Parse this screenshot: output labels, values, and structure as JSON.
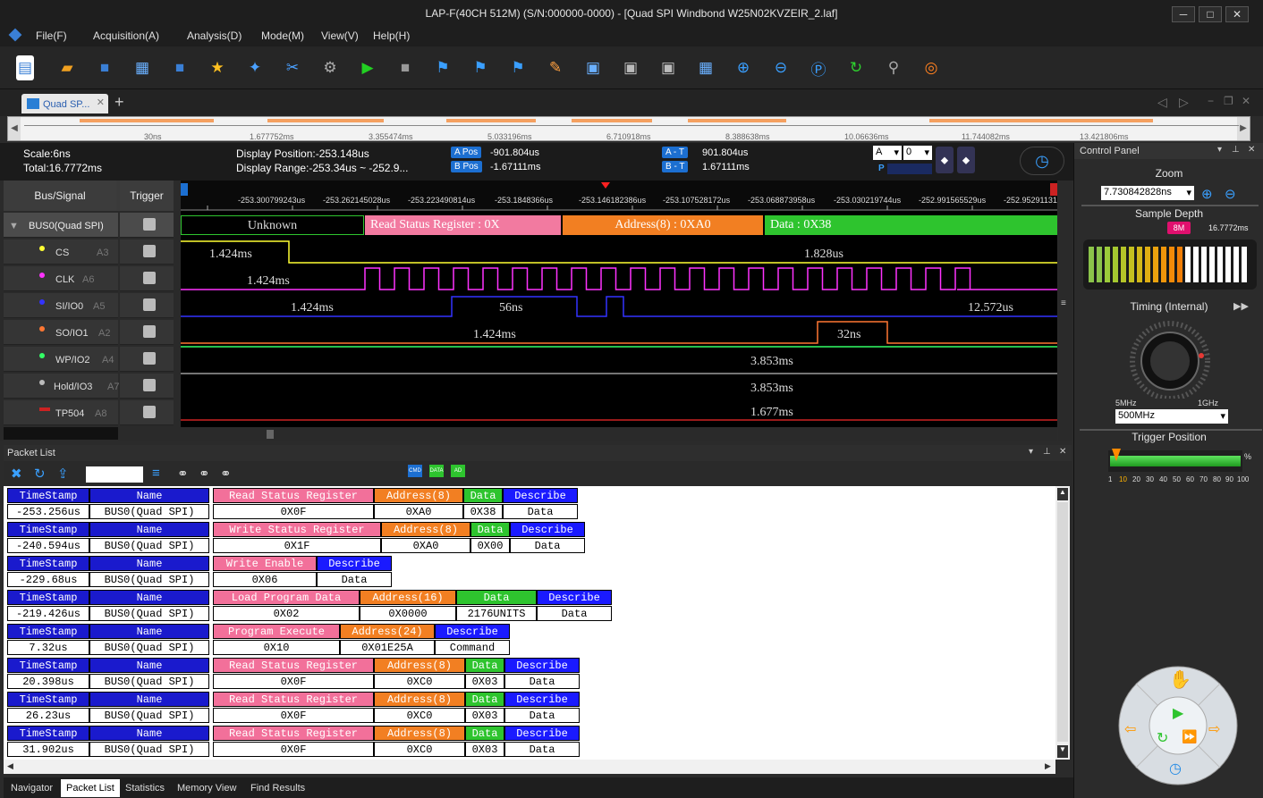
{
  "window": {
    "title": "LAP-F(40CH 512M) (S/N:000000-0000) - [Quad SPI Windbond W25N02KVZEIR_2.laf]"
  },
  "menu": [
    "File(F)",
    "Acquisition(A)",
    "Analysis(D)",
    "Mode(M)",
    "View(V)",
    "Help(H)"
  ],
  "tab": {
    "label": "Quad SP..."
  },
  "overview": {
    "ticks": [
      "30ns",
      "1.677752ms",
      "3.355474ms",
      "5.033196ms",
      "6.710918ms",
      "8.388638ms",
      "10.06636ms",
      "11.744082ms",
      "13.421806ms"
    ]
  },
  "info": {
    "scale": "Scale:6ns",
    "total": "Total:16.7772ms",
    "display_position": "Display Position:-253.148us",
    "display_range": "Display Range:-253.34us ~ -252.9...",
    "a_pos_label": "A Pos",
    "a_pos": "-901.804us",
    "b_pos_label": "B Pos",
    "b_pos": "-1.67111ms",
    "a_t_label": "A - T",
    "a_t": "901.804us",
    "b_t_label": "B - T",
    "b_t": "1.67111ms",
    "sel_a": "A",
    "sel_0": "0",
    "p": "P"
  },
  "signal_header": {
    "bus_signal": "Bus/Signal",
    "trigger": "Trigger"
  },
  "signals": [
    {
      "name": "BUS0(Quad SPI)",
      "pin": "",
      "color": "#dddddd"
    },
    {
      "name": "CS",
      "pin": "A3",
      "color": "#ffff33"
    },
    {
      "name": "CLK",
      "pin": "A6",
      "color": "#ff33ff"
    },
    {
      "name": "SI/IO0",
      "pin": "A5",
      "color": "#3333ff"
    },
    {
      "name": "SO/IO1",
      "pin": "A2",
      "color": "#ff7733"
    },
    {
      "name": "WP/IO2",
      "pin": "A4",
      "color": "#33ff66"
    },
    {
      "name": "Hold/IO3",
      "pin": "A7",
      "color": "#bbbbbb"
    },
    {
      "name": "TP504",
      "pin": "A8",
      "color": "#cc2222"
    }
  ],
  "time_ruler": [
    "-253.300799243us",
    "-253.262145028us",
    "-253.223490814us",
    "-253.1848366us",
    "-253.146182386us",
    "-253.107528172us",
    "-253.068873958us",
    "-253.030219744us",
    "-252.991565529us",
    "-252.95291131"
  ],
  "bus_segments": [
    {
      "text": "Unknown",
      "color": "#000000",
      "fg": "#dddddd"
    },
    {
      "text": "Read Status Register : 0X",
      "color": "#f27aa0",
      "fg": "#ffffff"
    },
    {
      "text": "Address(8) : 0XA0",
      "color": "#f27f22",
      "fg": "#ffffff"
    },
    {
      "text": "Data : 0X38",
      "color": "#2ec42e",
      "fg": "#ffffff"
    }
  ],
  "wave_labels": {
    "cs_a": "1.424ms",
    "cs_b": "1.828us",
    "clk_a": "1.424ms",
    "si_a": "1.424ms",
    "si_b": "56ns",
    "si_c": "12.572us",
    "so_a": "1.424ms",
    "so_b": "32ns",
    "wp": "3.853ms",
    "hold": "3.853ms",
    "tp": "1.677ms"
  },
  "control_panel": {
    "title": "Control Panel",
    "zoom": "Zoom",
    "zoom_value": "7.730842828ns",
    "sample_depth": "Sample Depth",
    "depth_badge": "8M",
    "depth_value": "16.7772ms",
    "timing": "Timing (Internal)",
    "knob_min": "5MHz",
    "knob_max": "1GHz",
    "rate": "500MHz",
    "trigger_position": "Trigger Position",
    "pct": "%",
    "trig_ticks": [
      "1",
      "10",
      "20",
      "30",
      "40",
      "50",
      "60",
      "70",
      "80",
      "90",
      "100"
    ]
  },
  "packet_list": {
    "title": "Packet List",
    "legend": [
      "CMD",
      "DATA",
      "AD"
    ],
    "packets": [
      {
        "ts": "-253.256us",
        "name": "BUS0(Quad SPI)",
        "cmd": "Read Status Register",
        "cmd_val": "0X0F",
        "addr": "Address(8)",
        "addr_val": "0XA0",
        "data": "Data",
        "data_val": "0X38",
        "desc_val": "Data"
      },
      {
        "ts": "-240.594us",
        "name": "BUS0(Quad SPI)",
        "cmd": "Write Status Register",
        "cmd_val": "0X1F",
        "addr": "Address(8)",
        "addr_val": "0XA0",
        "data": "Data",
        "data_val": "0X00",
        "desc_val": "Data"
      },
      {
        "ts": "-229.68us",
        "name": "BUS0(Quad SPI)",
        "cmd": "Write Enable",
        "cmd_val": "0X06",
        "desc_val": "Data"
      },
      {
        "ts": "-219.426us",
        "name": "BUS0(Quad SPI)",
        "cmd": "Load Program Data",
        "cmd_val": "0X02",
        "addr": "Address(16)",
        "addr_val": "0X0000",
        "data": "Data",
        "data_val": "2176UNITS",
        "desc_val": "Data"
      },
      {
        "ts": "7.32us",
        "name": "BUS0(Quad SPI)",
        "cmd": "Program Execute",
        "cmd_val": "0X10",
        "addr": "Address(24)",
        "addr_val": "0X01E25A",
        "desc_val": "Command"
      },
      {
        "ts": "20.398us",
        "name": "BUS0(Quad SPI)",
        "cmd": "Read Status Register",
        "cmd_val": "0X0F",
        "addr": "Address(8)",
        "addr_val": "0XC0",
        "data": "Data",
        "data_val": "0X03",
        "desc_val": "Data"
      },
      {
        "ts": "26.23us",
        "name": "BUS0(Quad SPI)",
        "cmd": "Read Status Register",
        "cmd_val": "0X0F",
        "addr": "Address(8)",
        "addr_val": "0XC0",
        "data": "Data",
        "data_val": "0X03",
        "desc_val": "Data"
      },
      {
        "ts": "31.902us",
        "name": "BUS0(Quad SPI)",
        "cmd": "Read Status Register",
        "cmd_val": "0X0F",
        "addr": "Address(8)",
        "addr_val": "0XC0",
        "data": "Data",
        "data_val": "0X03",
        "desc_val": "Data"
      }
    ],
    "col_ts": "TimeStamp",
    "col_name": "Name",
    "col_desc": "Describe"
  },
  "bottom_tabs": [
    "Navigator",
    "Packet List",
    "Statistics",
    "Memory View",
    "Find Results"
  ]
}
